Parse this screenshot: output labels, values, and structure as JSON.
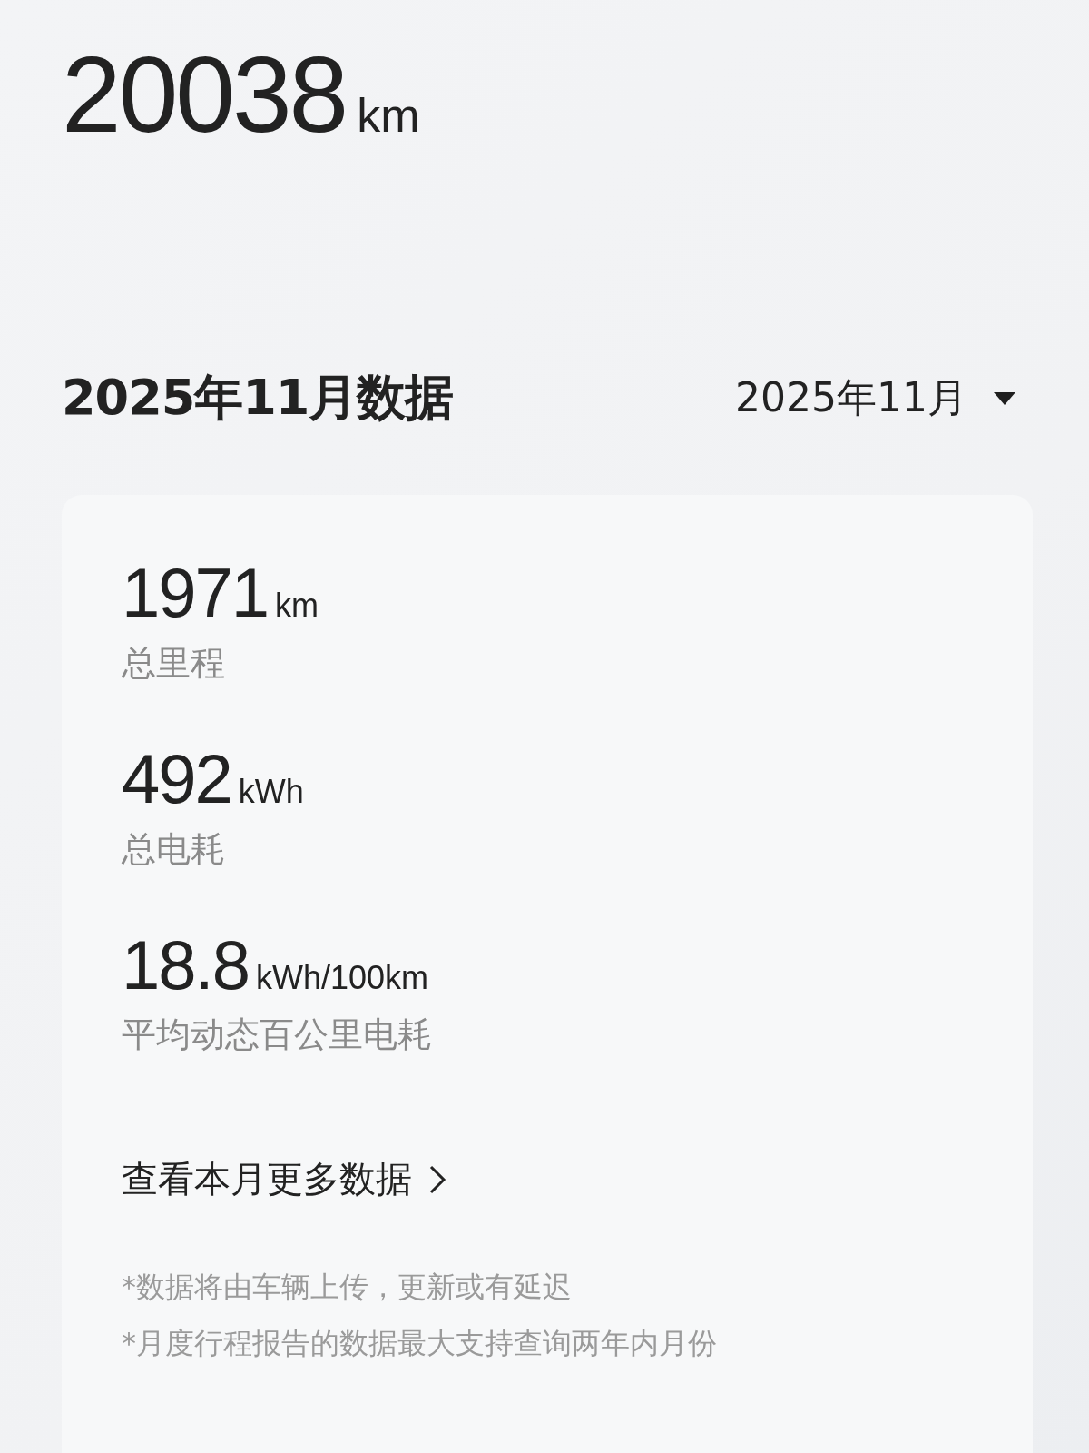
{
  "total": {
    "value": "20038",
    "unit": "km"
  },
  "section": {
    "title": "2025年11月数据",
    "month_picker": "2025年11月"
  },
  "stats": [
    {
      "value": "1971",
      "unit": "km",
      "label": "总里程"
    },
    {
      "value": "492",
      "unit": "kWh",
      "label": "总电耗"
    },
    {
      "value": "18.8",
      "unit": "kWh/100km",
      "label": "平均动态百公里电耗"
    }
  ],
  "more_link": "查看本月更多数据",
  "notes": [
    "*数据将由车辆上传，更新或有延迟",
    "*月度行程报告的数据最大支持查询两年内月份"
  ]
}
